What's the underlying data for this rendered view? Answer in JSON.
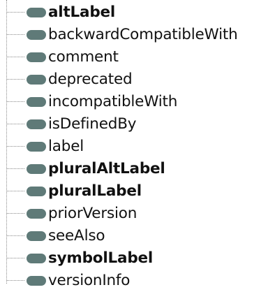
{
  "tree": {
    "items": [
      {
        "label": "altLabel",
        "bold": true
      },
      {
        "label": "backwardCompatibleWith",
        "bold": false
      },
      {
        "label": "comment",
        "bold": false
      },
      {
        "label": "deprecated",
        "bold": false
      },
      {
        "label": "incompatibleWith",
        "bold": false
      },
      {
        "label": "isDefinedBy",
        "bold": false
      },
      {
        "label": "label",
        "bold": false
      },
      {
        "label": "pluralAltLabel",
        "bold": true
      },
      {
        "label": "pluralLabel",
        "bold": true
      },
      {
        "label": "priorVersion",
        "bold": false
      },
      {
        "label": "seeAlso",
        "bold": false
      },
      {
        "label": "symbolLabel",
        "bold": true
      },
      {
        "label": "versionInfo",
        "bold": false
      }
    ],
    "icon": "annotation-property-icon",
    "icon_color": "#5f7a78"
  }
}
